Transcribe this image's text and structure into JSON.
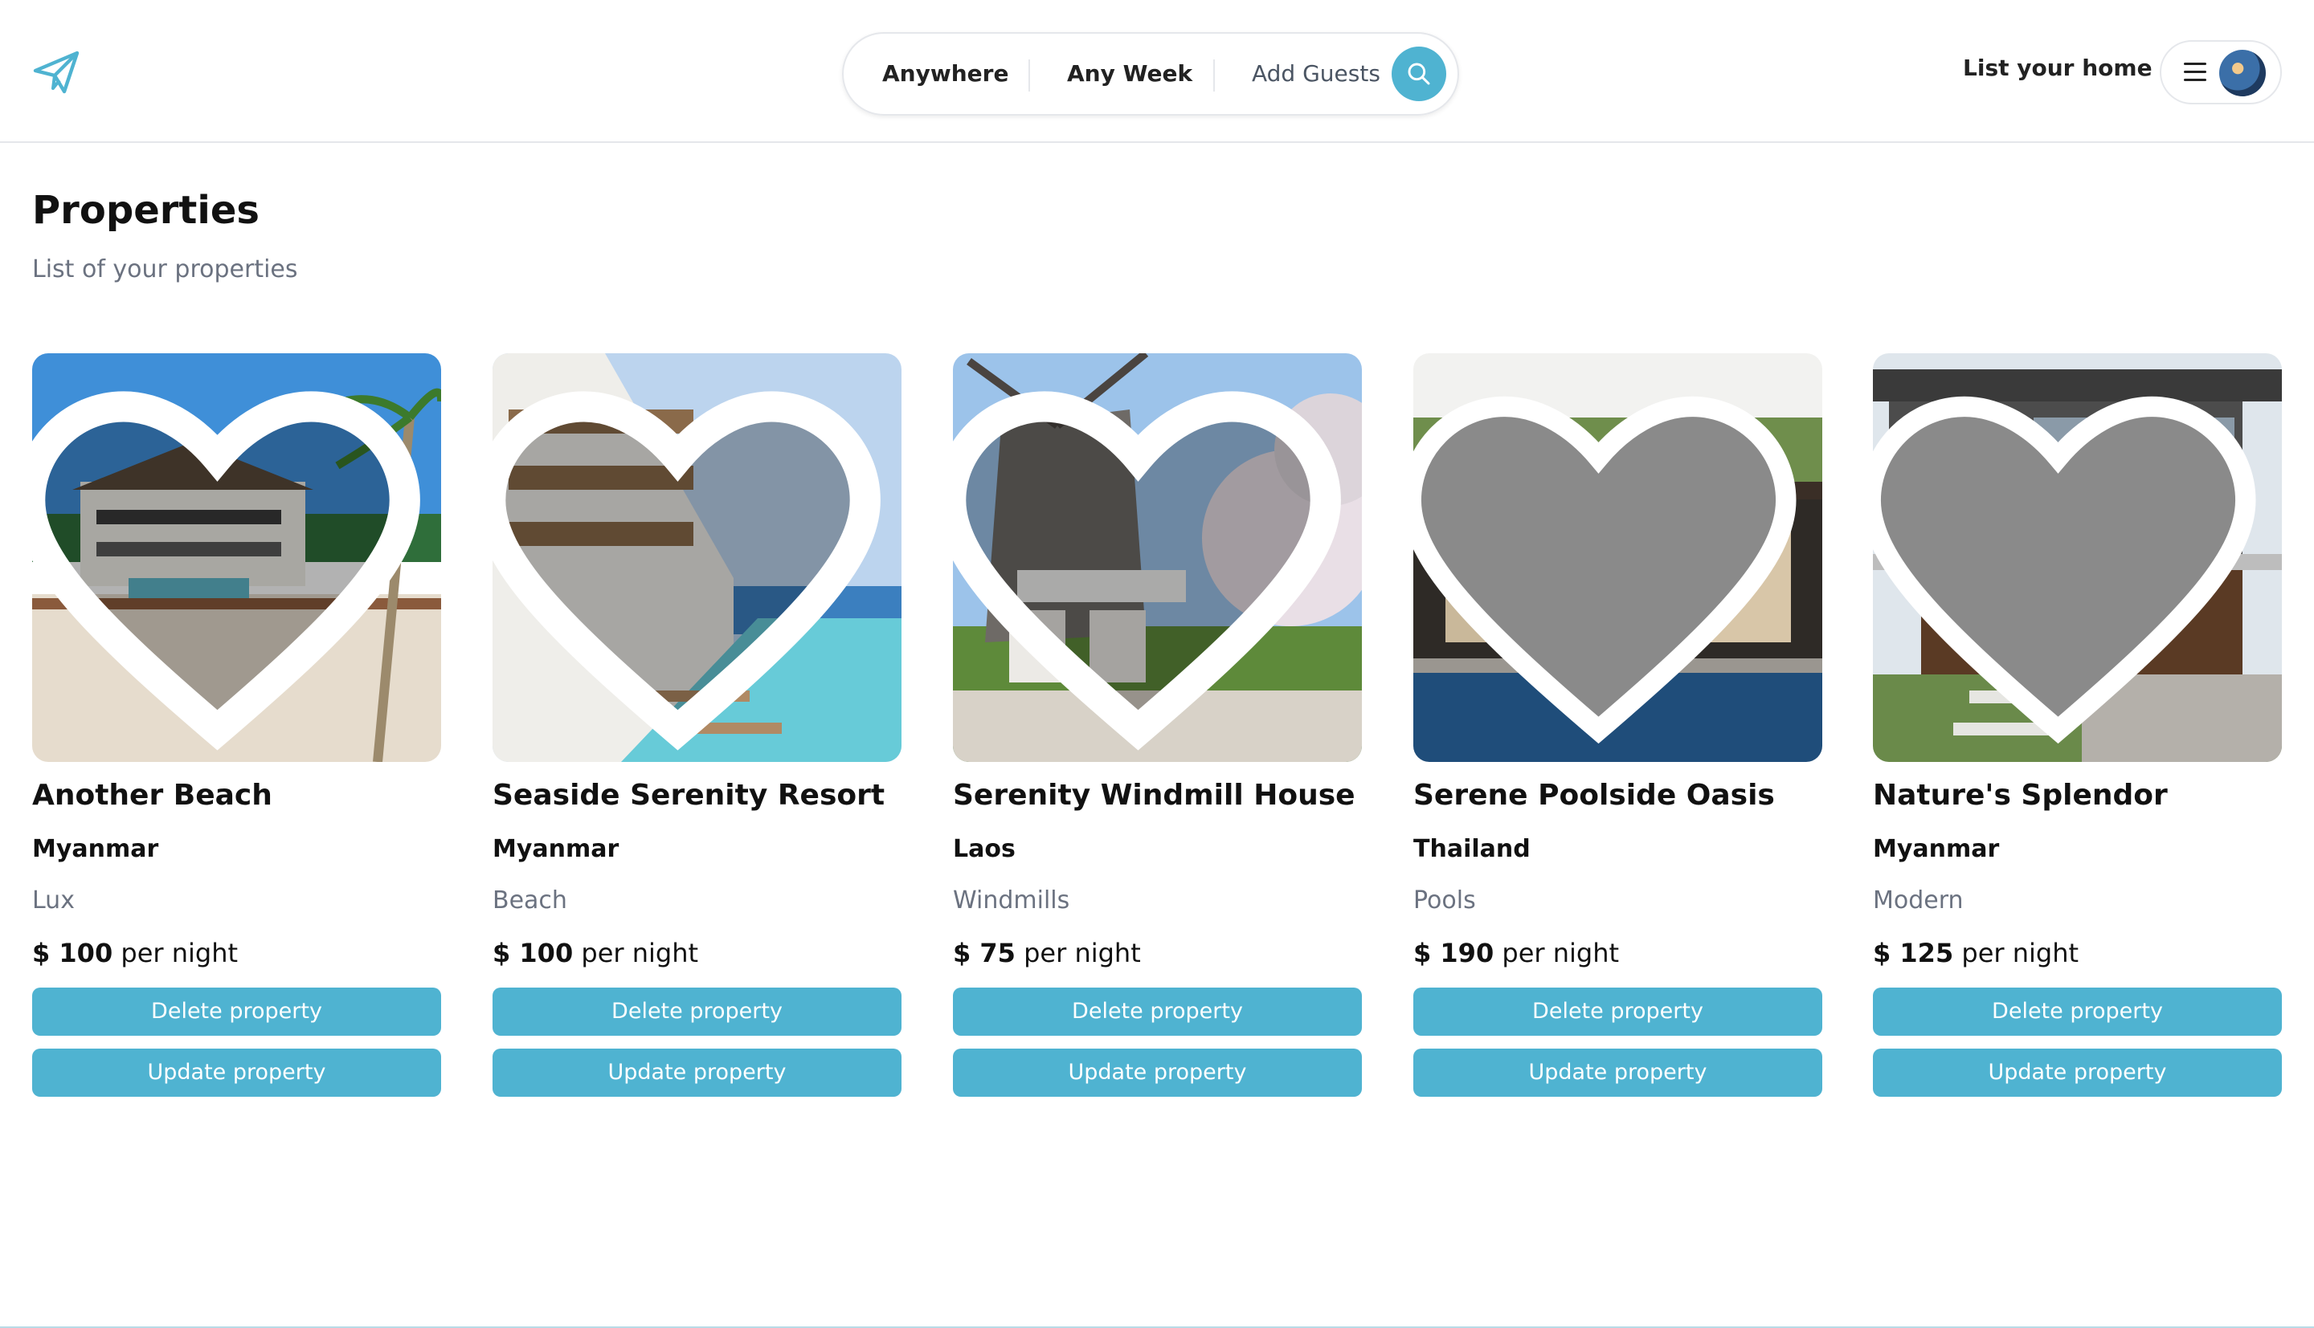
{
  "header": {
    "logo_icon": "paper-plane-icon",
    "search": {
      "where": "Anywhere",
      "when": "Any Week",
      "guests": "Add Guests",
      "button_icon": "search-icon"
    },
    "list_home": "List your home",
    "menu_icon": "hamburger-icon"
  },
  "page": {
    "title": "Properties",
    "subtitle": "List of your properties"
  },
  "colors": {
    "accent": "#4fb3d1"
  },
  "properties": [
    {
      "name": "Another Beach",
      "location": "Myanmar",
      "category": "Lux",
      "price": "$ 100",
      "price_suffix": "per night",
      "favorited": false
    },
    {
      "name": "Seaside Serenity Resort",
      "location": "Myanmar",
      "category": "Beach",
      "price": "$ 100",
      "price_suffix": "per night",
      "favorited": false
    },
    {
      "name": "Serenity Windmill House",
      "location": "Laos",
      "category": "Windmills",
      "price": "$ 75",
      "price_suffix": "per night",
      "favorited": false
    },
    {
      "name": "Serene Poolside Oasis",
      "location": "Thailand",
      "category": "Pools",
      "price": "$ 190",
      "price_suffix": "per night",
      "favorited": true
    },
    {
      "name": "Nature's Splendor",
      "location": "Myanmar",
      "category": "Modern",
      "price": "$ 125",
      "price_suffix": "per night",
      "favorited": true
    }
  ],
  "actions": {
    "delete_label": "Delete property",
    "update_label": "Update property"
  }
}
